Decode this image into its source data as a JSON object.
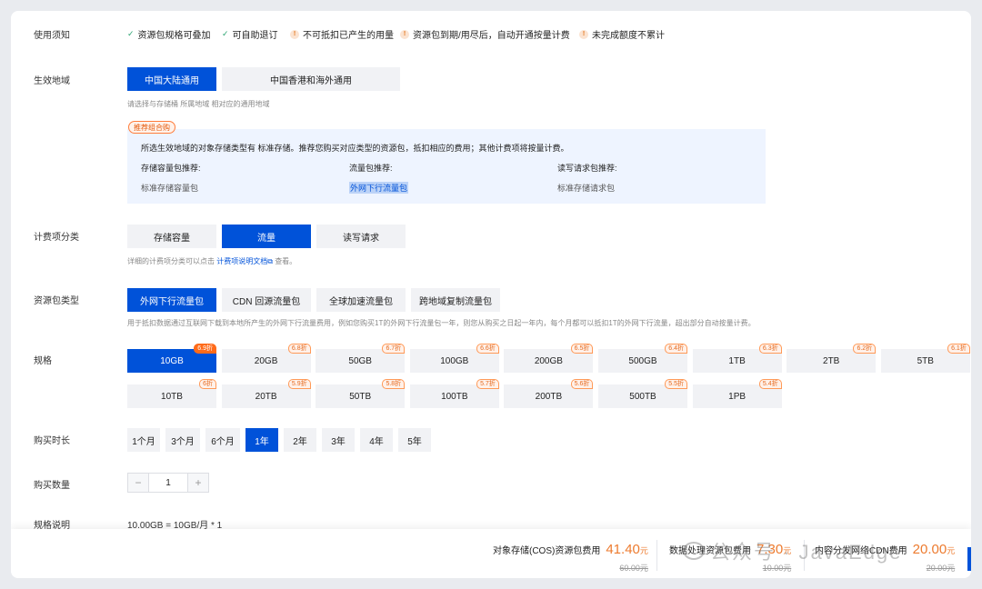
{
  "notices": {
    "label": "使用须知",
    "items": [
      {
        "text": "资源包规格可叠加",
        "icon": "check-icon"
      },
      {
        "text": "可自助退订",
        "icon": "check-icon"
      },
      {
        "text": "不可抵扣已产生的用量",
        "icon": "warning-icon"
      },
      {
        "text": "资源包到期/用尽后，自动开通按量计费",
        "icon": "warning-icon"
      },
      {
        "text": "未完成额度不累计",
        "icon": "warning-icon"
      }
    ]
  },
  "region": {
    "label": "生效地域",
    "options": [
      "中国大陆通用",
      "中国香港和海外通用"
    ],
    "selected": "中国大陆通用",
    "hint": "请选择与存储桶 所属地域 相对应的通用地域"
  },
  "recommend": {
    "tag": "推荐组合购",
    "desc": "所选生效地域的对象存储类型有 标准存储。推荐您购买对应类型的资源包，抵扣相应的费用；其他计费项将按量计费。",
    "cols": [
      {
        "title": "存储容量包推荐:",
        "value": "标准存储容量包"
      },
      {
        "title": "流量包推荐:",
        "value": "外网下行流量包"
      },
      {
        "title": "读写请求包推荐:",
        "value": "标准存储请求包"
      }
    ]
  },
  "billing": {
    "label": "计费项分类",
    "options": [
      "存储容量",
      "流量",
      "读写请求"
    ],
    "selected": "流量",
    "hint_prefix": "详细的计费项分类可以点击",
    "hint_link": "计费项说明文档",
    "hint_suffix": "查看。"
  },
  "package_type": {
    "label": "资源包类型",
    "options": [
      "外网下行流量包",
      "CDN 回源流量包",
      "全球加速流量包",
      "跨地域复制流量包"
    ],
    "selected": "外网下行流量包",
    "hint": "用于抵扣数据通过互联网下载到本地所产生的外网下行流量费用，例如您购买1T的外网下行流量包一年，则您从购买之日起一年内，每个月都可以抵扣1T的外网下行流量，超出部分自动按量计费。"
  },
  "spec": {
    "label": "规格",
    "selected": "10GB",
    "row1": [
      {
        "size": "10GB",
        "discount": "6.9折"
      },
      {
        "size": "20GB",
        "discount": "6.8折"
      },
      {
        "size": "50GB",
        "discount": "6.7折"
      },
      {
        "size": "100GB",
        "discount": "6.6折"
      },
      {
        "size": "200GB",
        "discount": "6.5折"
      },
      {
        "size": "500GB",
        "discount": "6.4折"
      },
      {
        "size": "1TB",
        "discount": "6.3折"
      },
      {
        "size": "2TB",
        "discount": "6.2折"
      },
      {
        "size": "5TB",
        "discount": "6.1折"
      }
    ],
    "row2": [
      {
        "size": "10TB",
        "discount": "6折"
      },
      {
        "size": "20TB",
        "discount": "5.9折"
      },
      {
        "size": "50TB",
        "discount": "5.8折"
      },
      {
        "size": "100TB",
        "discount": "5.7折"
      },
      {
        "size": "200TB",
        "discount": "5.6折"
      },
      {
        "size": "500TB",
        "discount": "5.5折"
      },
      {
        "size": "1PB",
        "discount": "5.4折"
      }
    ]
  },
  "duration": {
    "label": "购买时长",
    "options": [
      "1个月",
      "3个月",
      "6个月",
      "1年",
      "2年",
      "3年",
      "4年",
      "5年"
    ],
    "selected": "1年"
  },
  "quantity": {
    "label": "购买数量",
    "value": "1",
    "minus": "−",
    "plus": "+"
  },
  "spec_desc": {
    "label": "规格说明",
    "value": "10.00GB = 10GB/月 * 1"
  },
  "footer": {
    "fees": [
      {
        "label": "对象存储(COS)资源包费用",
        "value": "41.40",
        "unit": "元",
        "old": "60.00元"
      },
      {
        "label": "数据处理资源包费用",
        "value": "7.30",
        "unit": "元",
        "old": "10.00元"
      },
      {
        "label": "内容分发网络CDN费用",
        "value": "20.00",
        "unit": "元",
        "old": "20.00元"
      }
    ]
  },
  "watermark": "公众号 · JavaEdge",
  "colors": {
    "primary": "#0052d9",
    "accent": "#ed7b2f",
    "discount": "#ff6b1a"
  }
}
